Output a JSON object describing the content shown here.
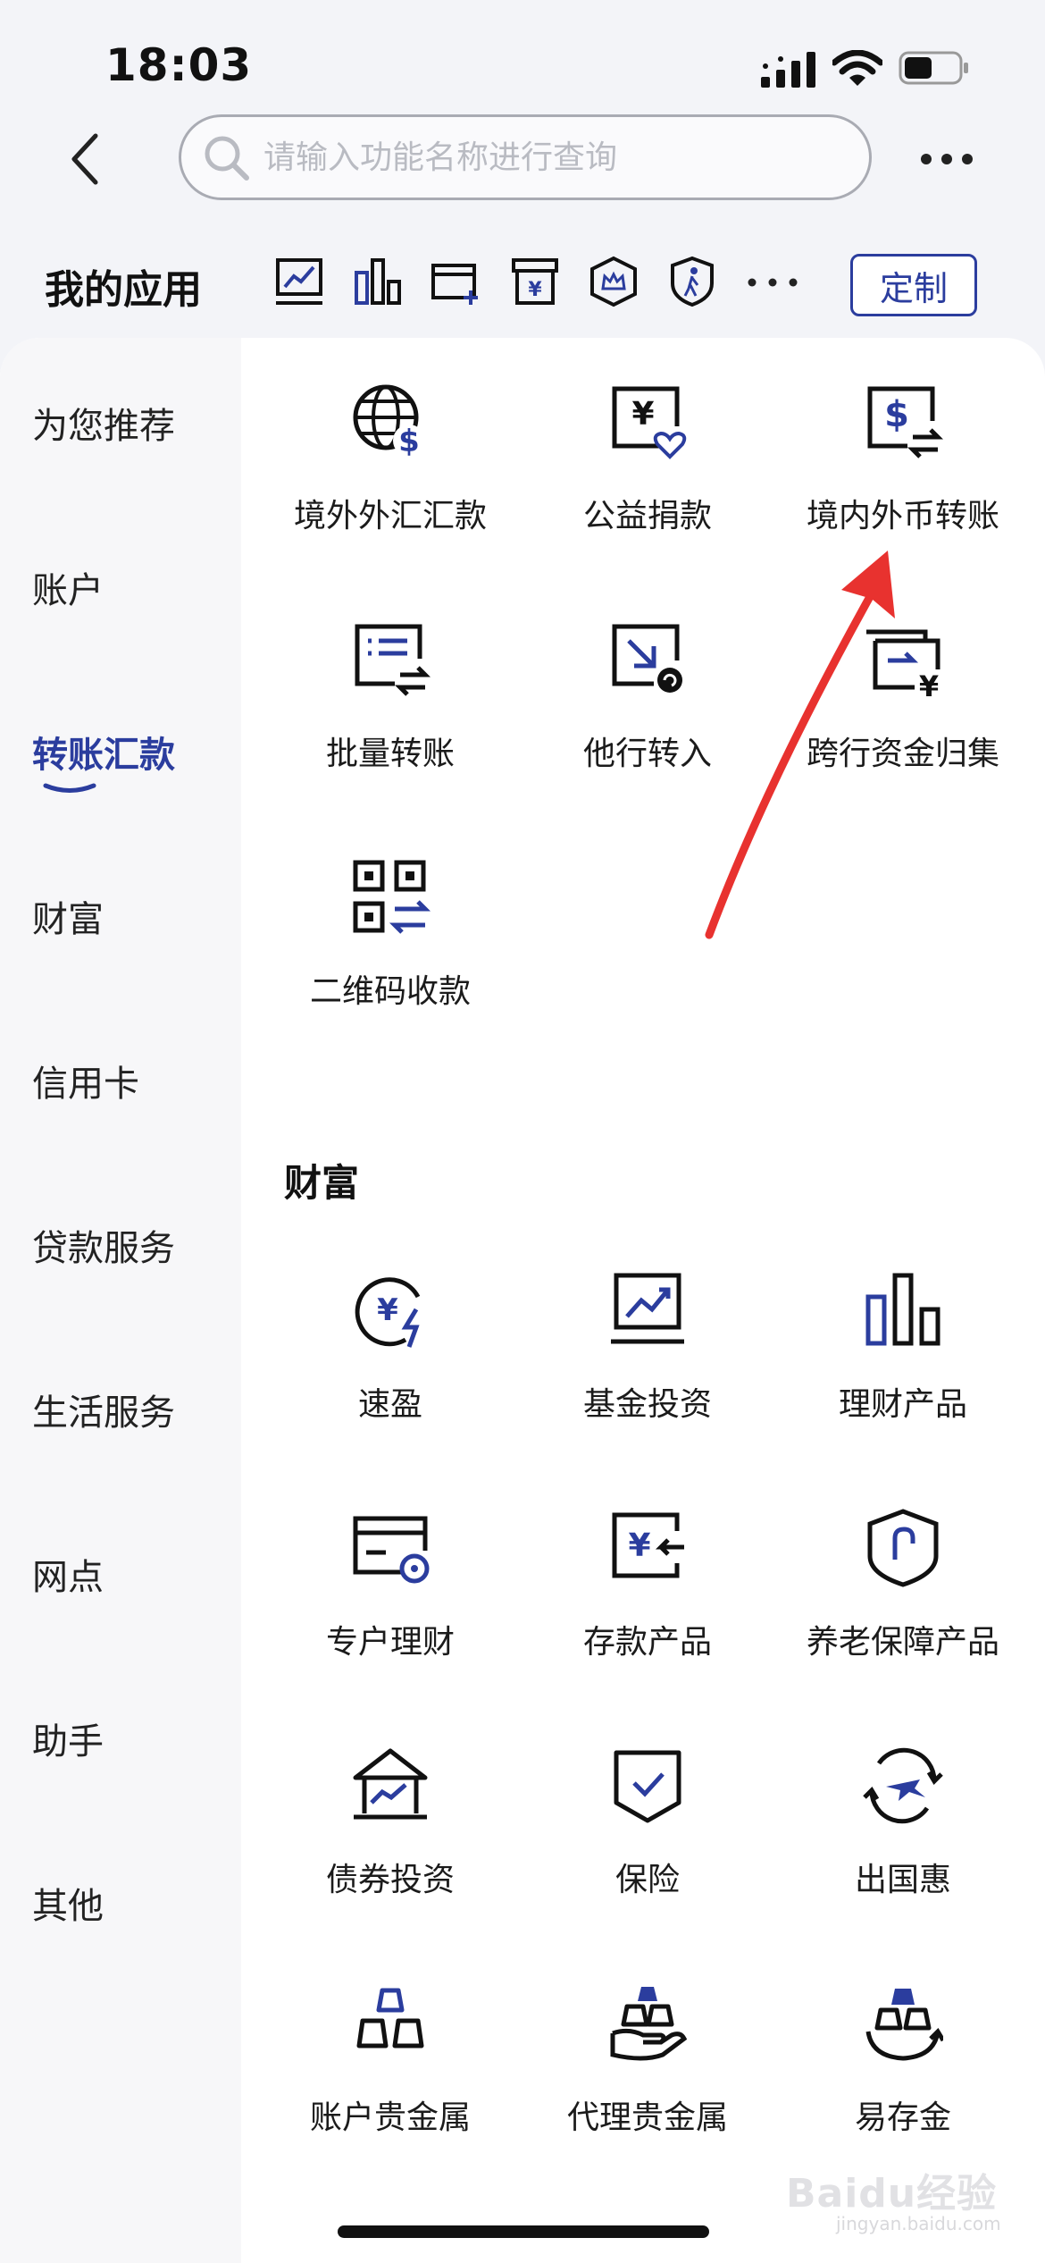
{
  "status_bar": {
    "time": "18:03"
  },
  "search": {
    "placeholder": "请输入功能名称进行查询"
  },
  "my_apps": {
    "title": "我的应用",
    "customize_label": "定制"
  },
  "sidebar": {
    "items": [
      {
        "label": "为您推荐"
      },
      {
        "label": "账户"
      },
      {
        "label": "转账汇款",
        "active": true
      },
      {
        "label": "财富"
      },
      {
        "label": "信用卡"
      },
      {
        "label": "贷款服务"
      },
      {
        "label": "生活服务"
      },
      {
        "label": "网点"
      },
      {
        "label": "助手"
      },
      {
        "label": "其他"
      }
    ]
  },
  "transfer_section": {
    "items": [
      {
        "label": "境外外汇汇款",
        "icon": "globe-dollar-icon"
      },
      {
        "label": "公益捐款",
        "icon": "yuan-heart-icon"
      },
      {
        "label": "境内外币转账",
        "icon": "dollar-exchange-icon"
      },
      {
        "label": "批量转账",
        "icon": "list-exchange-icon"
      },
      {
        "label": "他行转入",
        "icon": "transfer-in-icon"
      },
      {
        "label": "跨行资金归集",
        "icon": "fund-collect-icon"
      },
      {
        "label": "二维码收款",
        "icon": "qr-code-icon"
      }
    ]
  },
  "wealth_section": {
    "title": "财富",
    "items": [
      {
        "label": "速盈",
        "icon": "quick-yuan-icon"
      },
      {
        "label": "基金投资",
        "icon": "fund-chart-icon"
      },
      {
        "label": "理财产品",
        "icon": "bar-chart-icon"
      },
      {
        "label": "专户理财",
        "icon": "card-icon"
      },
      {
        "label": "存款产品",
        "icon": "deposit-icon"
      },
      {
        "label": "养老保障产品",
        "icon": "pension-shield-icon"
      },
      {
        "label": "债券投资",
        "icon": "bond-house-icon"
      },
      {
        "label": "保险",
        "icon": "insurance-check-icon"
      },
      {
        "label": "出国惠",
        "icon": "plane-icon"
      },
      {
        "label": "账户贵金属",
        "icon": "gold-bars-icon"
      },
      {
        "label": "代理贵金属",
        "icon": "gold-hand-icon"
      },
      {
        "label": "易存金",
        "icon": "gold-cycle-icon"
      }
    ]
  },
  "watermark": {
    "text": "Baidu经验",
    "sub": "jingyan.baidu.com"
  },
  "colors": {
    "accent": "#2b3d9e",
    "arrow": "#e8322f"
  }
}
